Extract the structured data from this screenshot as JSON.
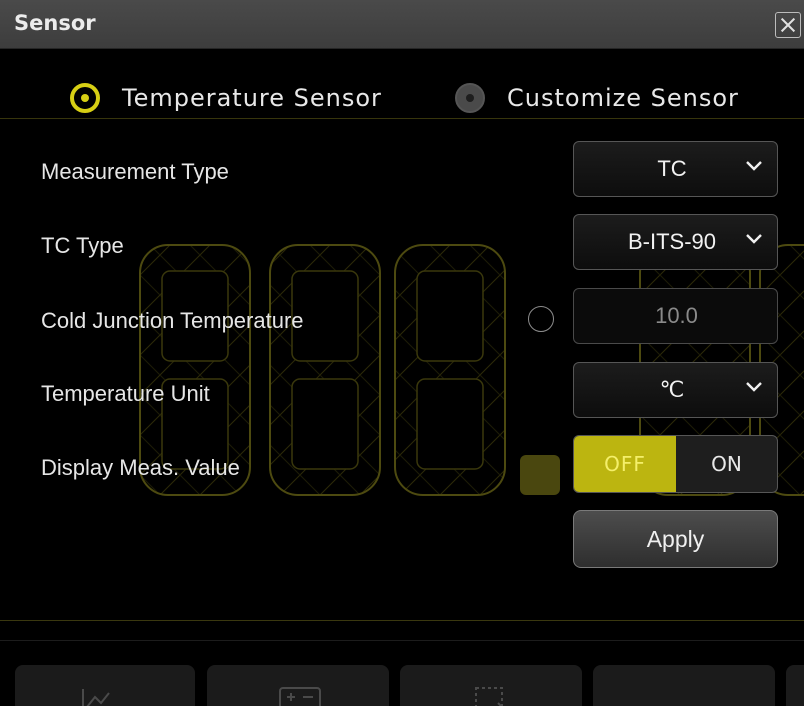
{
  "dialog": {
    "title": "Sensor",
    "close_icon": "close-icon"
  },
  "sensor_modes": [
    {
      "label": "Temperature Sensor",
      "selected": true
    },
    {
      "label": "Customize Sensor",
      "selected": false
    }
  ],
  "settings": {
    "measurement_type": {
      "label": "Measurement Type",
      "value": "TC"
    },
    "tc_type": {
      "label": "TC Type",
      "value": "B-ITS-90"
    },
    "cold_junction": {
      "label": "Cold Junction Temperature",
      "value": "10.0"
    },
    "temperature_unit": {
      "label": "Temperature Unit",
      "value": "℃"
    },
    "display_meas": {
      "label": "Display Meas. Value",
      "off_label": "OFF",
      "on_label": "ON",
      "state": "OFF"
    }
  },
  "apply_label": "Apply",
  "colors": {
    "accent": "#d7cf14",
    "toggle_active": "#bcb510",
    "titlebar": "#454545",
    "background": "#000000"
  },
  "dock_icons": [
    "chart-icon",
    "calculator-icon",
    "select-icon",
    "more-icon"
  ]
}
